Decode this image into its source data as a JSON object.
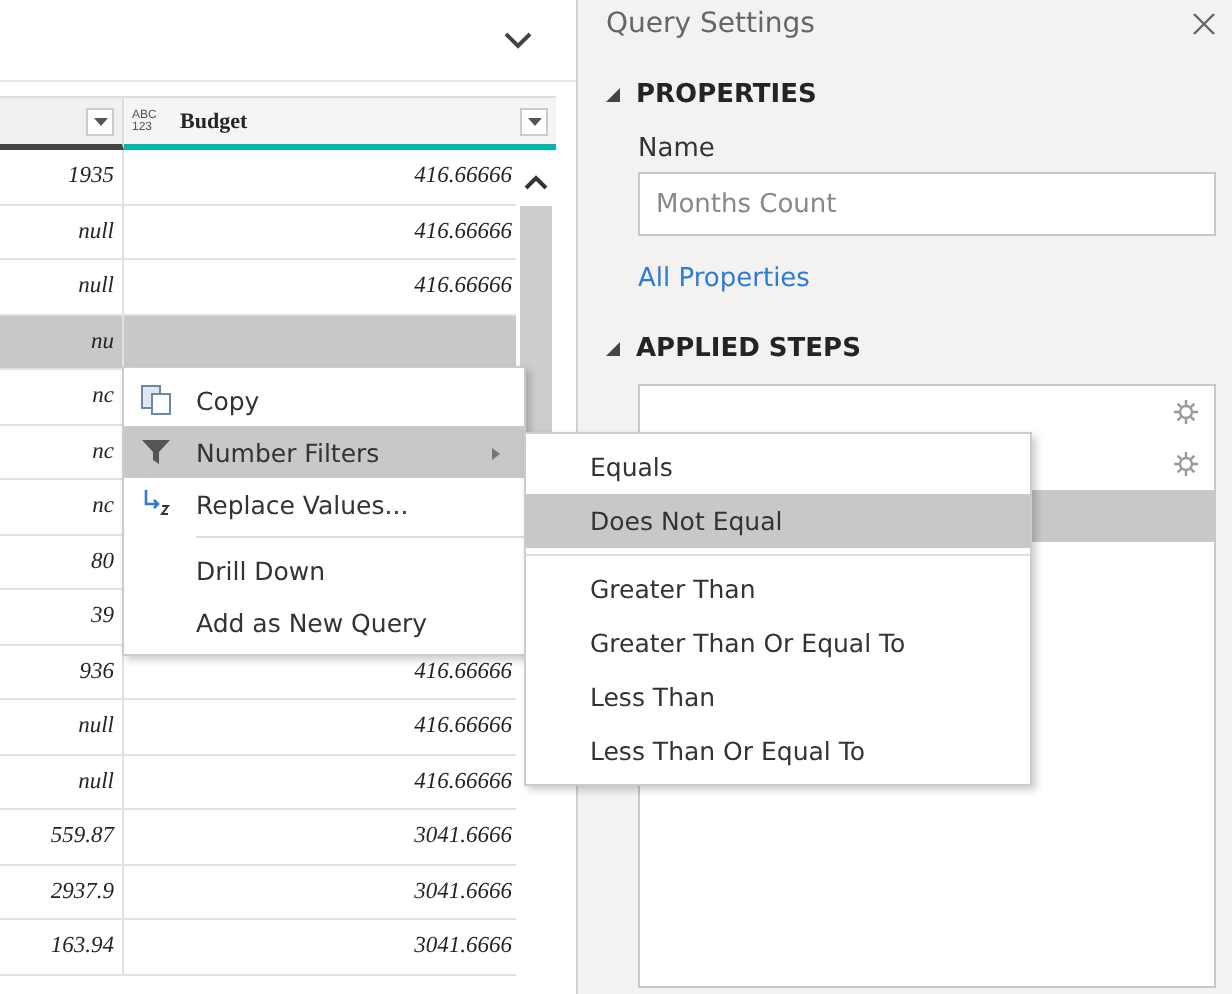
{
  "grid": {
    "columns": [
      {
        "label": "Budget",
        "type_icon": "ABC 123"
      }
    ],
    "rows": [
      {
        "value": "1935",
        "budget": "416.66666",
        "selected": false
      },
      {
        "value": "null",
        "budget": "416.66666",
        "selected": false
      },
      {
        "value": "null",
        "budget": "416.66666",
        "selected": false
      },
      {
        "value": "nu",
        "selected": true
      },
      {
        "value": "nc",
        "selected": false
      },
      {
        "value": "nc",
        "selected": false
      },
      {
        "value": "nc",
        "selected": false
      },
      {
        "value": "80",
        "selected": false
      },
      {
        "value": "39",
        "selected": false
      },
      {
        "value": "936",
        "budget": "416.66666",
        "selected": false
      },
      {
        "value": "null",
        "budget": "416.66666",
        "selected": false
      },
      {
        "value": "null",
        "budget": "416.66666",
        "selected": false
      },
      {
        "value": "559.87",
        "budget": "3041.6666",
        "selected": false
      },
      {
        "value": "2937.9",
        "budget": "3041.6666",
        "selected": false
      },
      {
        "value": "163.94",
        "budget": "3041.6666",
        "selected": false
      }
    ]
  },
  "context_menu": {
    "items": [
      {
        "kind": "item",
        "label": "Copy",
        "selected": false
      },
      {
        "kind": "submenu",
        "label": "Number Filters",
        "selected": true
      },
      {
        "kind": "item",
        "label": "Replace Values...",
        "selected": false
      },
      {
        "kind": "separator"
      },
      {
        "kind": "item",
        "label": "Drill Down",
        "selected": false
      },
      {
        "kind": "item",
        "label": "Add as New Query",
        "selected": false
      }
    ]
  },
  "submenu": {
    "items": [
      {
        "kind": "item",
        "label": "Equals",
        "selected": false
      },
      {
        "kind": "item",
        "label": "Does Not Equal",
        "selected": true
      },
      {
        "kind": "separator"
      },
      {
        "kind": "item",
        "label": "Greater Than",
        "selected": false
      },
      {
        "kind": "item",
        "label": "Greater Than Or Equal To",
        "selected": false
      },
      {
        "kind": "item",
        "label": "Less Than",
        "selected": false
      },
      {
        "kind": "item",
        "label": "Less Than Or Equal To",
        "selected": false
      }
    ]
  },
  "query_settings": {
    "title": "Query Settings",
    "properties_heading": "PROPERTIES",
    "name_label": "Name",
    "name_value": "Months Count",
    "all_properties_link": "All Properties",
    "applied_steps_heading": "APPLIED STEPS",
    "steps": [
      {
        "kind": "settings",
        "selected": false
      },
      {
        "kind": "settings",
        "selected": false
      },
      {
        "kind": "plain",
        "selected": true
      }
    ]
  }
}
